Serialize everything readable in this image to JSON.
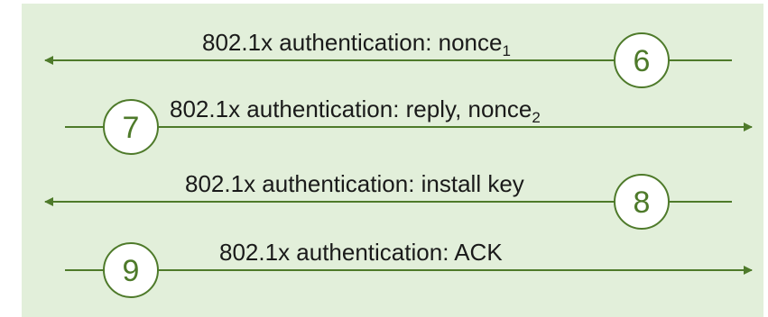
{
  "colors": {
    "background": "#e2efda",
    "line": "#4e7a2a",
    "circle_fill": "#ffffff",
    "step_text": "#4e7a2a",
    "label_text": "#1a1a1a"
  },
  "messages": [
    {
      "label": "802.1x authentication: nonce",
      "subscript": "1",
      "step": "6",
      "direction": "left"
    },
    {
      "label": "802.1x authentication: reply, nonce",
      "subscript": "2",
      "step": "7",
      "direction": "right"
    },
    {
      "label": "802.1x authentication: install key",
      "subscript": "",
      "step": "8",
      "direction": "left"
    },
    {
      "label": "802.1x authentication: ACK",
      "subscript": "",
      "step": "9",
      "direction": "right"
    }
  ]
}
